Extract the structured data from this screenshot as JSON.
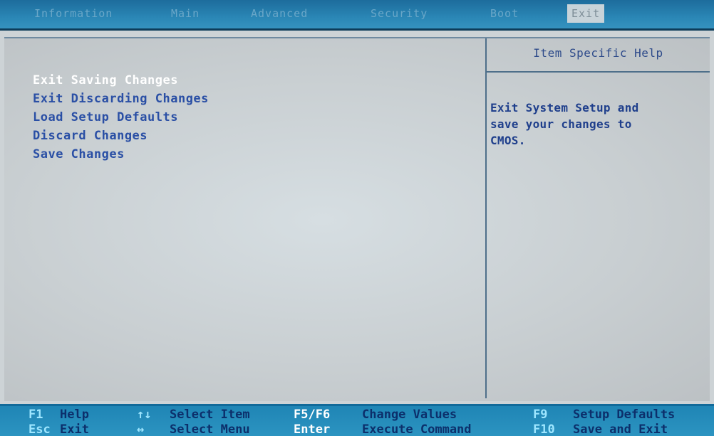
{
  "menu": {
    "tabs": [
      {
        "label": "Information"
      },
      {
        "label": "Main"
      },
      {
        "label": "Advanced"
      },
      {
        "label": "Security"
      },
      {
        "label": "Boot"
      },
      {
        "label": "Exit"
      }
    ],
    "active_tab": "Exit"
  },
  "exit_menu": {
    "options": [
      {
        "label": "Exit Saving Changes",
        "selected": true
      },
      {
        "label": "Exit Discarding Changes",
        "selected": false
      },
      {
        "label": "Load Setup Defaults",
        "selected": false
      },
      {
        "label": "Discard Changes",
        "selected": false
      },
      {
        "label": "Save Changes",
        "selected": false
      }
    ]
  },
  "help": {
    "title": "Item Specific Help",
    "lines": [
      "Exit System Setup and",
      "save your changes to",
      "CMOS."
    ]
  },
  "keys": {
    "row1": [
      {
        "key": "F1",
        "desc": "Help"
      },
      {
        "key": "↑↓",
        "desc": "Select Item"
      },
      {
        "key": "F5/F6",
        "desc": "Change Values"
      },
      {
        "key": "F9",
        "desc": "Setup Defaults"
      }
    ],
    "row2": [
      {
        "key": "Esc",
        "desc": "Exit"
      },
      {
        "key": "↔",
        "desc": "Select Menu"
      },
      {
        "key": "Enter",
        "desc": "Execute Command"
      },
      {
        "key": "F10",
        "desc": "Save and Exit"
      }
    ]
  },
  "colors": {
    "menubar": "#2a86b5",
    "panel": "#cdd3d6",
    "option_text": "#2a4fa5",
    "selected_text": "#ffffff",
    "keybar": "#2d95c2"
  }
}
